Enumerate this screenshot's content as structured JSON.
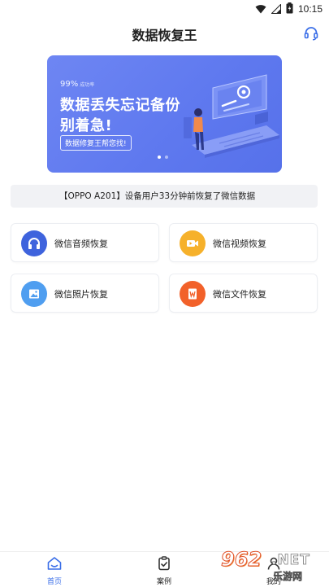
{
  "status_bar": {
    "time": "10:15"
  },
  "header": {
    "title": "数据恢复王"
  },
  "banner": {
    "rate_value": "99%",
    "rate_caption": "成功率",
    "line1": "数据丢失忘记备份",
    "line2": "别着急!",
    "tag": "数据修复王帮您找!"
  },
  "notice": {
    "text": "【OPPO A201】设备用户33分钟前恢复了微信数据"
  },
  "features": [
    {
      "label": "微信音频恢复",
      "color": "#3e63dd",
      "icon": "headphones-icon"
    },
    {
      "label": "微信视频恢复",
      "color": "#f6b12b",
      "icon": "video-camera-icon"
    },
    {
      "label": "微信照片恢复",
      "color": "#4f9ef0",
      "icon": "image-icon"
    },
    {
      "label": "微信文件恢复",
      "color": "#f2612a",
      "icon": "document-icon"
    }
  ],
  "tabs": [
    {
      "label": "首页",
      "active": true,
      "icon": "home-icon"
    },
    {
      "label": "案例",
      "active": false,
      "icon": "clipboard-icon"
    },
    {
      "label": "我的",
      "active": false,
      "icon": "user-icon"
    }
  ],
  "watermark": {
    "number": "962",
    "suffix": ".NET",
    "caption": "乐游网"
  },
  "colors": {
    "accent": "#3a6ee8",
    "banner": "#6680f0"
  }
}
